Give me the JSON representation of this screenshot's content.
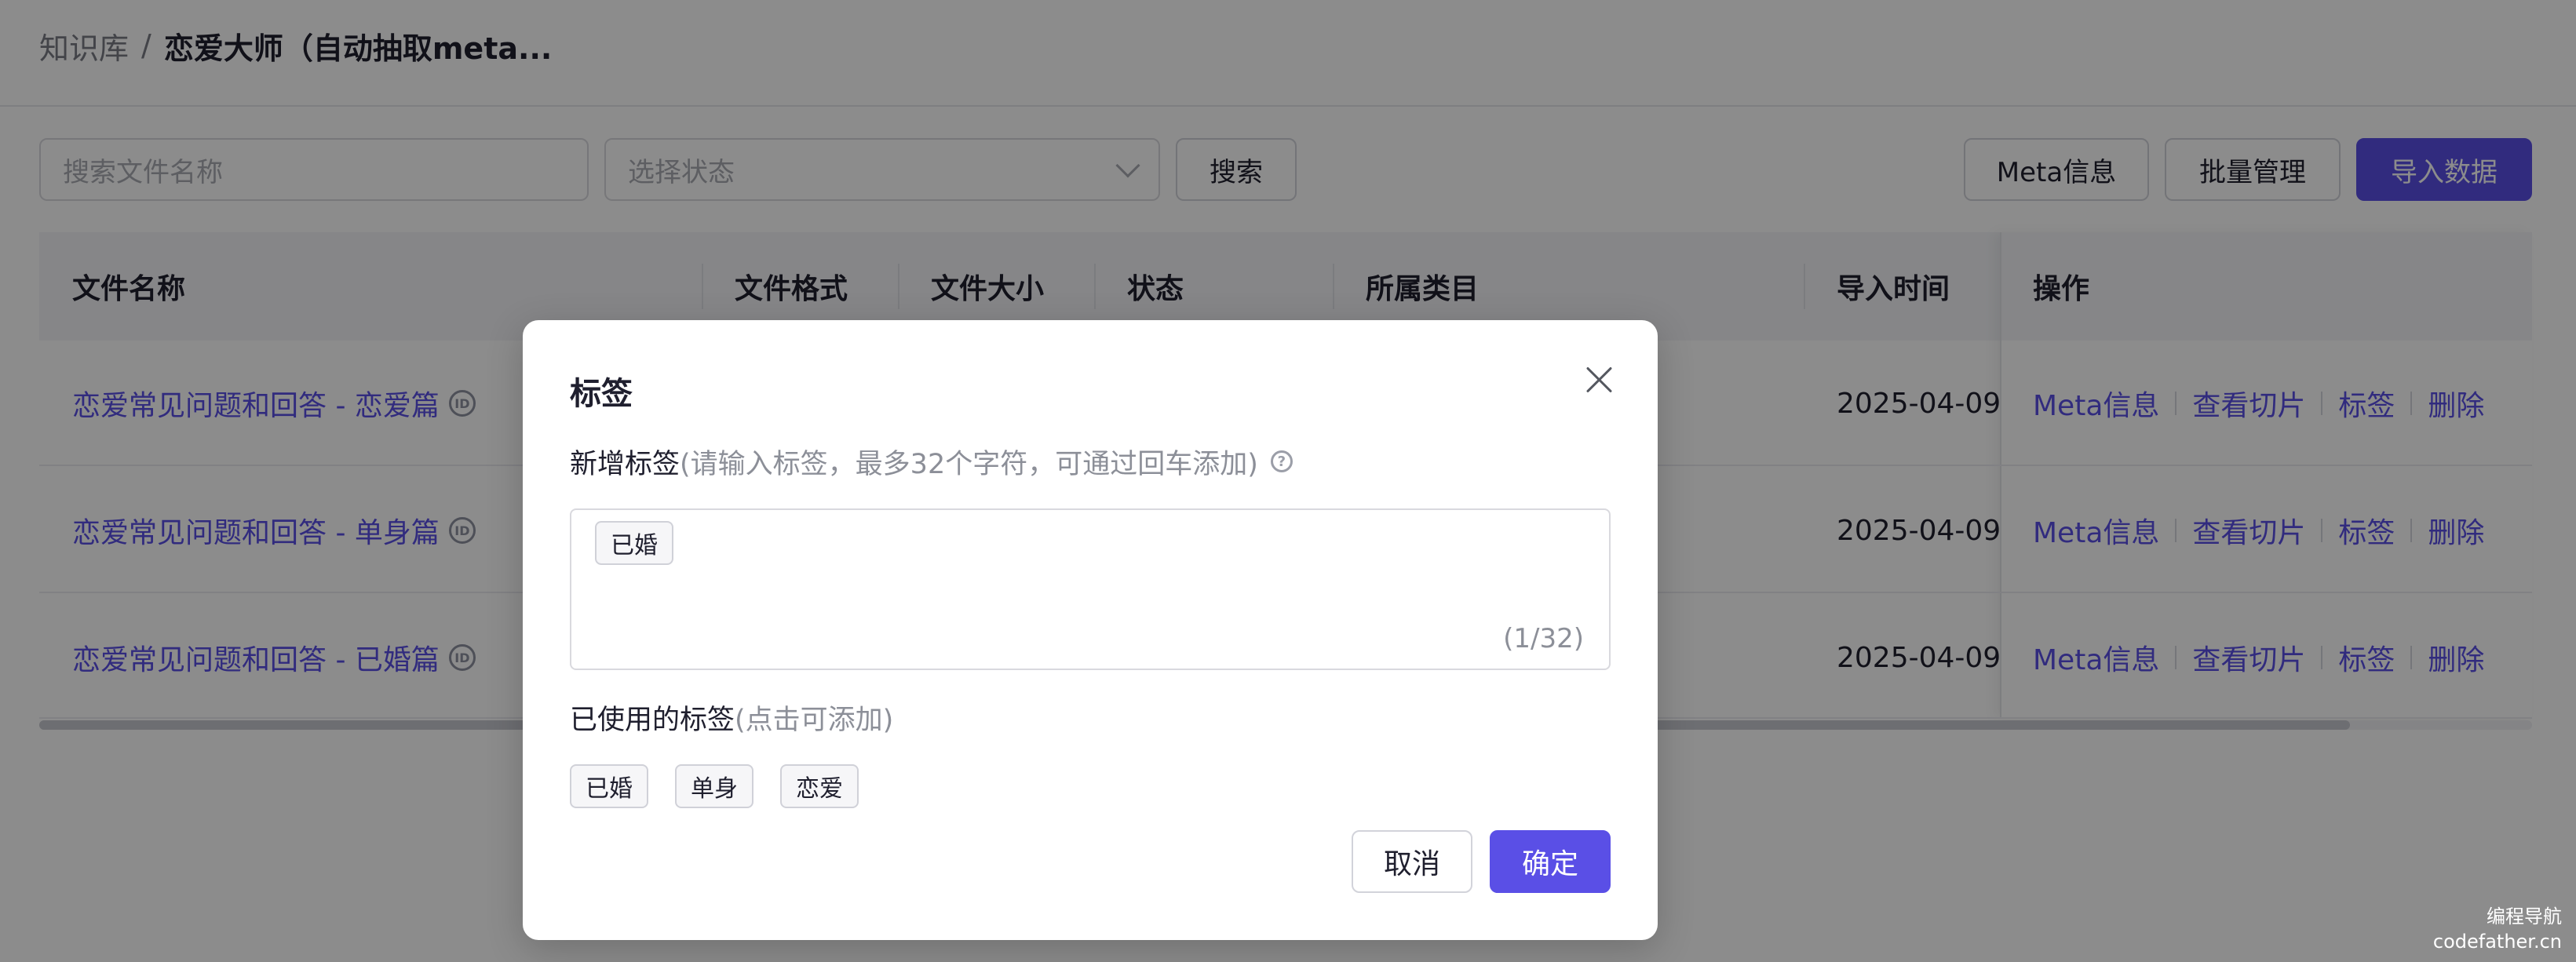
{
  "breadcrumb": {
    "root": "知识库",
    "separator": "/",
    "current": "恋爱大师（自动抽取meta..."
  },
  "toolbar": {
    "search_placeholder": "搜索文件名称",
    "status_placeholder": "选择状态",
    "search_label": "搜索",
    "meta_label": "Meta信息",
    "batch_label": "批量管理",
    "import_label": "导入数据"
  },
  "table": {
    "columns": [
      "文件名称",
      "文件格式",
      "文件大小",
      "状态",
      "所属类目",
      "导入时间",
      "操作"
    ],
    "rows": [
      {
        "name": "恋爱常见问题和回答 - 恋爱篇",
        "time": "2025-04-09"
      },
      {
        "name": "恋爱常见问题和回答 - 单身篇",
        "time": "2025-04-09"
      },
      {
        "name": "恋爱常见问题和回答 - 已婚篇",
        "time": "2025-04-09"
      }
    ],
    "row_actions": [
      "Meta信息",
      "查看切片",
      "标签",
      "删除"
    ]
  },
  "modal": {
    "title": "标签",
    "new_tag_label": "新增标签",
    "new_tag_hint": "(请输入标签，最多32个字符，可通过回车添加)",
    "current_tags": [
      "已婚"
    ],
    "counter": "(1/32)",
    "used_label": "已使用的标签",
    "used_hint": "(点击可添加)",
    "used_tags": [
      "已婚",
      "单身",
      "恋爱"
    ],
    "cancel_label": "取消",
    "confirm_label": "确定"
  },
  "watermark": {
    "line1": "编程导航",
    "line2": "codefather.cn"
  },
  "colors": {
    "primary": "#5a4fe6",
    "overlay": "rgba(0,0,0,0.45)"
  },
  "icons": [
    "chevron-down-icon",
    "info-badge-icon",
    "external-link-icon",
    "close-icon",
    "help-icon"
  ]
}
